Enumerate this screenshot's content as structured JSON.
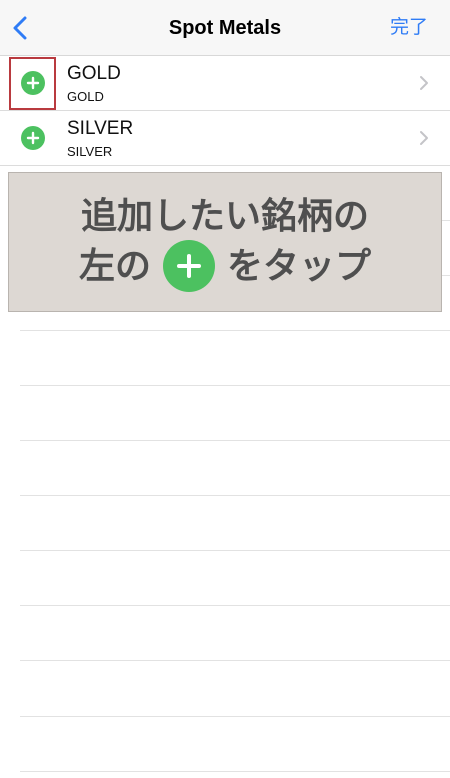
{
  "navbar": {
    "back_icon": "chevron-left-icon",
    "title": "Spot Metals",
    "done_label": "完了"
  },
  "items": [
    {
      "name": "GOLD",
      "sub": "GOLD"
    },
    {
      "name": "SILVER",
      "sub": "SILVER"
    }
  ],
  "overlay": {
    "line1": "追加したい銘柄の",
    "line2_before": "左の",
    "line2_after": "をタップ",
    "plus_icon": "plus-circle-icon"
  },
  "colors": {
    "accent": "#2f7cf6",
    "add_green": "#4cc160",
    "highlight_red": "#b93a3f",
    "overlay_bg": "#ddd8d3"
  }
}
